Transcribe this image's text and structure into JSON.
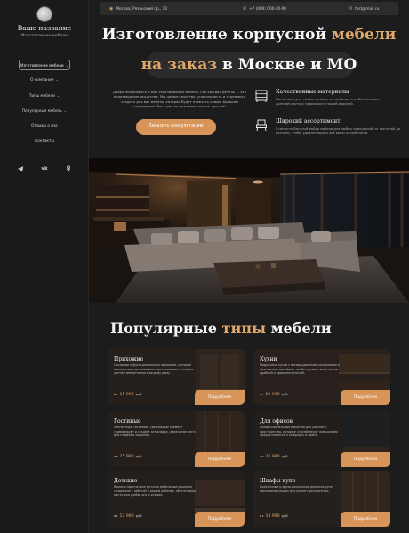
{
  "brand": {
    "title": "Ваше название",
    "subtitle": "Изготовление мебели"
  },
  "nav": [
    {
      "label": "Изготовление мебели",
      "chevron": true
    },
    {
      "label": "О компании",
      "chevron": true
    },
    {
      "label": "Типы мебели",
      "chevron": true
    },
    {
      "label": "Популярные мебель",
      "chevron": true
    },
    {
      "label": "Отзывы о нас",
      "chevron": false
    },
    {
      "label": "Контакты",
      "chevron": false
    }
  ],
  "socials": {
    "telegram": "◢",
    "vk": "vk",
    "odnoklassniki": "ǂ"
  },
  "topbar": {
    "address": "Москва, Рязанский пр., 10",
    "phone": "+7 (000) 000-00-00",
    "email": "test@mail.ru"
  },
  "hero": {
    "title_part1": "Изготовление корпусной ",
    "title_accent1": "мебели",
    "title_accent2": "на заказ",
    "title_part2": " в Москве и МО",
    "intro": "Добро пожаловать в мир эксклюзивной мебели, где каждая деталь — это произведение искусства. Мы ценим качество, уникальность и стремимся создать для вас мебель, которая будет отвечать самым высоким стандартам. Ваш дом заслуживает только лучшее!",
    "cta": "Заказать консультацию"
  },
  "features": [
    {
      "icon": "dresser-icon",
      "title": "Качественные материалы",
      "text": "Мы используем только лучшие материалы, что обеспечивает долговечность и надежность нашей изделий."
    },
    {
      "icon": "chair-icon",
      "title": "Широкий ассортимент",
      "text": "У нас есть богатый выбор мебели для любых помещений, от гостиной до спальни, чтобы удовлетворить все ваши потребности."
    }
  ],
  "popular": {
    "title_part1": "Популярные ",
    "title_accent": "типы",
    "title_part2": " мебели",
    "price_prefix": "от",
    "currency": "руб",
    "button": "Подробнее",
    "cards": [
      {
        "name": "Прихожие",
        "desc": "Стильные и функциональные прихожие, которые помогут вам организовать пространство и создать уютное впечатление каждому дому.",
        "price": "15 990"
      },
      {
        "name": "Кухни",
        "desc": "Модульные кухни с инновационными решениями и практичной дизайном, чтобы сделать вашу кухню удобной и привлекательной.",
        "price": "50 990"
      },
      {
        "name": "Гостиные",
        "desc": "Элегантные гостиные, где каждый элемент гармонирует и создает атмосферу, идеальное место для отдыха и общения.",
        "price": "25 990"
      },
      {
        "name": "Для офисов",
        "desc": "Профессиональные решения для рабочего пространства, которые способствуют повышению продуктивности и комфорту в офисе.",
        "price": "20 990"
      },
      {
        "name": "Детские",
        "desc": "Яркие и практичные детская мебельные решения, созданные с заботой о вашем ребенке, обеспечивая место для учебы, игр и отдыха.",
        "price": "12 990"
      },
      {
        "name": "Шкафы купе",
        "desc": "Практичные и функциональные решения купе, максимизирующих доступное пространство.",
        "price": "18 990"
      }
    ]
  }
}
